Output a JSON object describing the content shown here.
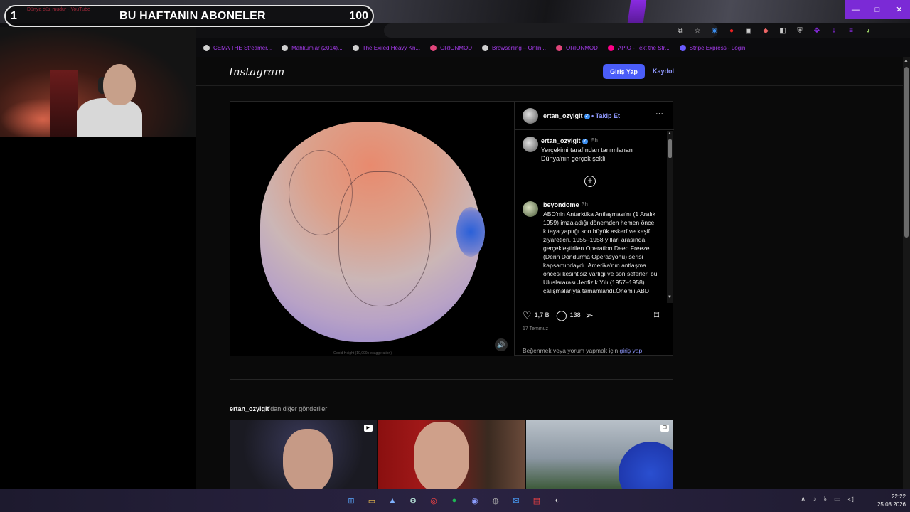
{
  "overlay": {
    "left_count": "1",
    "title": "BU HAFTANIN ABONELER",
    "right_count": "100",
    "faint_text": "Dünya düz mudur - YouTube"
  },
  "window_controls": {
    "minimize": "—",
    "maximize": "□",
    "close": "✕"
  },
  "bookmarks": [
    {
      "label": "CEMA THE Streamer..."
    },
    {
      "label": "Mahkumlar (2014)..."
    },
    {
      "label": "The Exiled Heavy Kn..."
    },
    {
      "label": "ORIONMOD"
    },
    {
      "label": "Browserling – Onlin..."
    },
    {
      "label": "ORIONMOD"
    },
    {
      "label": "APIO - Text the Str..."
    },
    {
      "label": "Stripe Express - Login"
    }
  ],
  "header": {
    "logo": "Instagram",
    "login_button": "Giriş Yap",
    "signup_link": "Kaydol"
  },
  "post": {
    "author": "ertan_ozyigit",
    "follow": "• Takip Et",
    "more": "···",
    "media_caption": "Geoid Height (10,000x exaggeration)",
    "caption": {
      "user": "ertan_ozyigit",
      "time": "5h",
      "text": "Yerçekimi tarafından tanımlanan Dünya'nın gerçek şekli"
    },
    "comment": {
      "user": "beyondome",
      "time": "3h",
      "text": "ABD'nin Antarktika Antlaşması'nı (1 Aralık 1959) imzaladığı dönemden hemen önce kıtaya yaptığı son büyük askerî ve keşif ziyaretleri, 1955–1958 yılları arasında gerçekleştirilen Operation Deep Freeze (Derin Dondurma Operasyonu) serisi kapsamındaydı. Amerika'nın antlaşma öncesi kesintisiz varlığı ve son seferleri bu Uluslararası Jeofizik Yılı (1957–1958) çalışmalarıyla tamamlandı.Önemli ABD"
    },
    "likes": "1,7 B",
    "comments_count": "138",
    "date": "17 Temmuz",
    "login_note_prefix": "Beğenmek veya yorum yapmak için ",
    "login_note_link": "giriş yap",
    "login_note_suffix": "."
  },
  "more_posts": {
    "user": "ertan_ozyigit",
    "suffix": "'dan diğer gönderiler"
  },
  "clock": {
    "time": "22:22",
    "date": "25.08.2026"
  }
}
